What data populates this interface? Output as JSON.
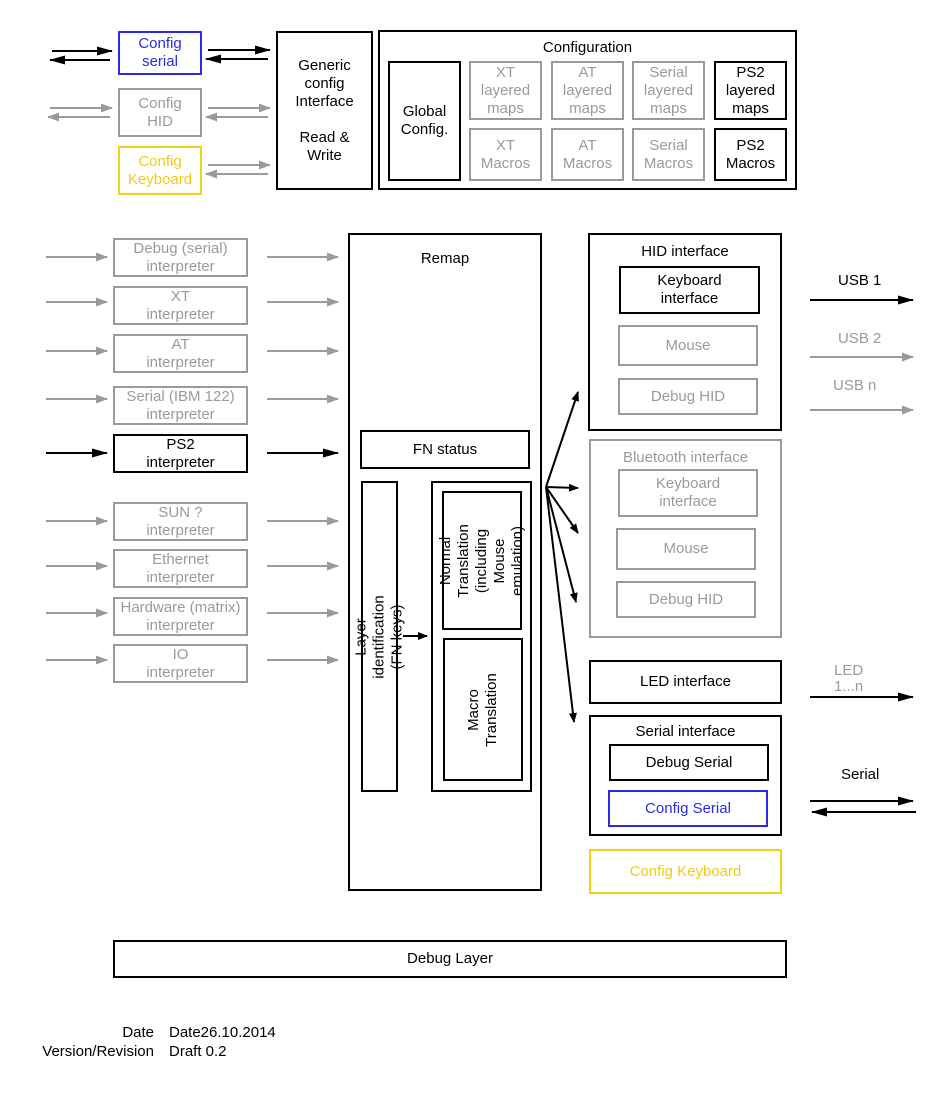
{
  "colors": {
    "active": "#000000",
    "inactive": "#9a9a9a",
    "config_serial": "#2a2ae8",
    "config_keyboard": "#f2cc14"
  },
  "config_sources": [
    {
      "label": "Config\nserial",
      "state": "blue"
    },
    {
      "label": "Config\nHID",
      "state": "gray"
    },
    {
      "label": "Config\nKeyboard",
      "state": "yellow"
    }
  ],
  "generic_config": {
    "label": "Generic\nconfig\nInterface\n\nRead &\nWrite"
  },
  "configuration": {
    "title": "Configuration",
    "global": "Global\nConfig.",
    "maps": [
      {
        "label": "XT\nlayered\nmaps",
        "state": "gray"
      },
      {
        "label": "AT\nlayered\nmaps",
        "state": "gray"
      },
      {
        "label": "Serial\nlayered\nmaps",
        "state": "gray"
      },
      {
        "label": "PS2\nlayered\nmaps",
        "state": "active"
      }
    ],
    "macros": [
      {
        "label": "XT\nMacros",
        "state": "gray"
      },
      {
        "label": "AT\nMacros",
        "state": "gray"
      },
      {
        "label": "Serial\nMacros",
        "state": "gray"
      },
      {
        "label": "PS2\nMacros",
        "state": "active"
      }
    ]
  },
  "interpreters": [
    {
      "label": "Debug (serial)\ninterpreter",
      "state": "gray"
    },
    {
      "label": "XT\ninterpreter",
      "state": "gray"
    },
    {
      "label": "AT\ninterpreter",
      "state": "gray"
    },
    {
      "label": "Serial (IBM 122)\ninterpreter",
      "state": "gray"
    },
    {
      "label": "PS2\ninterpreter",
      "state": "active"
    },
    {
      "label": "SUN ?\ninterpreter",
      "state": "gray"
    },
    {
      "label": "Ethernet\ninterpreter",
      "state": "gray"
    },
    {
      "label": "Hardware (matrix)\ninterpreter",
      "state": "gray"
    },
    {
      "label": "IO\ninterpreter",
      "state": "gray"
    }
  ],
  "remap": {
    "title": "Remap",
    "fn_status": "FN status",
    "layer_identification": "Layer identification (FN keys)",
    "normal_translation": "Normal\nTranslation\n(including\nMouse emulation)",
    "macro_translation": "Macro\nTranslation"
  },
  "hid_interface": {
    "title": "HID interface",
    "keyboard": "Keyboard\ninterface",
    "mouse": "Mouse",
    "debug": "Debug HID"
  },
  "bluetooth_interface": {
    "title": "Bluetooth interface",
    "keyboard": "Keyboard\ninterface",
    "mouse": "Mouse",
    "debug": "Debug HID"
  },
  "led_interface": "LED interface",
  "serial_interface": {
    "title": "Serial interface",
    "debug_serial": "Debug Serial",
    "config_serial": "Config Serial"
  },
  "config_keyboard_out": "Config Keyboard",
  "outputs": {
    "usb1": "USB 1",
    "usb2": "USB 2",
    "usbn": "USB n",
    "led": "LED\n1...n",
    "serial": "Serial"
  },
  "debug_layer": "Debug Layer",
  "meta": {
    "date_label": "Date",
    "date_value": "Date26.10.2014",
    "version_label": "Version/Revision",
    "version_value": "Draft 0.2"
  }
}
